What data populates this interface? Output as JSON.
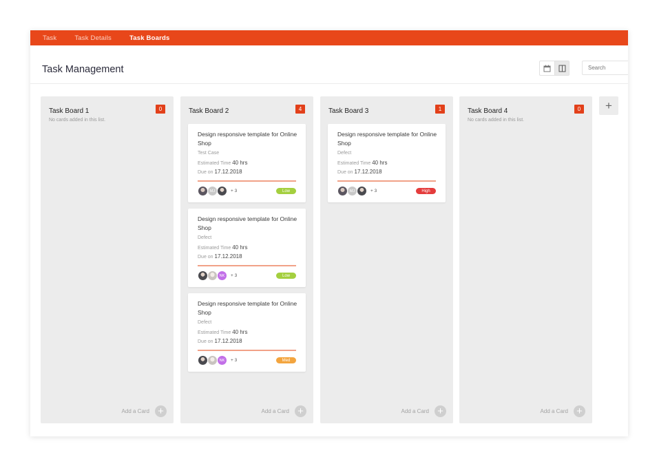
{
  "nav": {
    "items": [
      {
        "label": "Task"
      },
      {
        "label": "Task Details"
      },
      {
        "label": "Task Boards"
      }
    ],
    "active_index": 2,
    "color": "#e8471a"
  },
  "header": {
    "title": "Task Management",
    "search_placeholder": "Search",
    "view_icons": [
      "calendar-icon",
      "columns-icon"
    ]
  },
  "colors": {
    "badge": "#e2401a",
    "low": "#a4cf3f",
    "high": "#e43c3c",
    "med": "#f3a53f"
  },
  "add_card_label": "Add a Card",
  "add_list_icon": "plus-icon",
  "columns": [
    {
      "title": "Task Board 1",
      "count": "0",
      "empty_text": "No cards added in this list.",
      "cards": []
    },
    {
      "title": "Task Board 2",
      "count": "4",
      "empty_text": "",
      "cards": [
        {
          "title": "Design responsive template for Online Shop",
          "type": "Test Case",
          "est_label": "Estimated Time",
          "est_value": "40 hrs",
          "due_label": "Due on",
          "due_value": "17.12.2018",
          "avatars": [
            "photo",
            "MJ",
            "photo"
          ],
          "more": "+ 3",
          "priority": "Low"
        },
        {
          "title": "Design responsive template for Online Shop",
          "type": "Defect",
          "est_label": "Estimated Time",
          "est_value": "40 hrs",
          "due_label": "Due on",
          "due_value": "17.12.2018",
          "avatars": [
            "photo",
            "photo",
            "NK"
          ],
          "more": "+ 3",
          "priority": "Low"
        },
        {
          "title": "Design responsive template for Online Shop",
          "type": "Defect",
          "est_label": "Estimated Time",
          "est_value": "40 hrs",
          "due_label": "Due on",
          "due_value": "17.12.2018",
          "avatars": [
            "photo",
            "photo",
            "NK"
          ],
          "more": "+ 3",
          "priority": "Med"
        }
      ]
    },
    {
      "title": "Task Board 3",
      "count": "1",
      "empty_text": "",
      "cards": [
        {
          "title": "Design responsive template for Online Shop",
          "type": "Defect",
          "est_label": "Estimated Time",
          "est_value": "40 hrs",
          "due_label": "Due on",
          "due_value": "17.12.2018",
          "avatars": [
            "photo",
            "MJ",
            "photo"
          ],
          "more": "+ 3",
          "priority": "High"
        }
      ]
    },
    {
      "title": "Task Board 4",
      "count": "0",
      "empty_text": "No cards added in this list.",
      "cards": []
    }
  ]
}
